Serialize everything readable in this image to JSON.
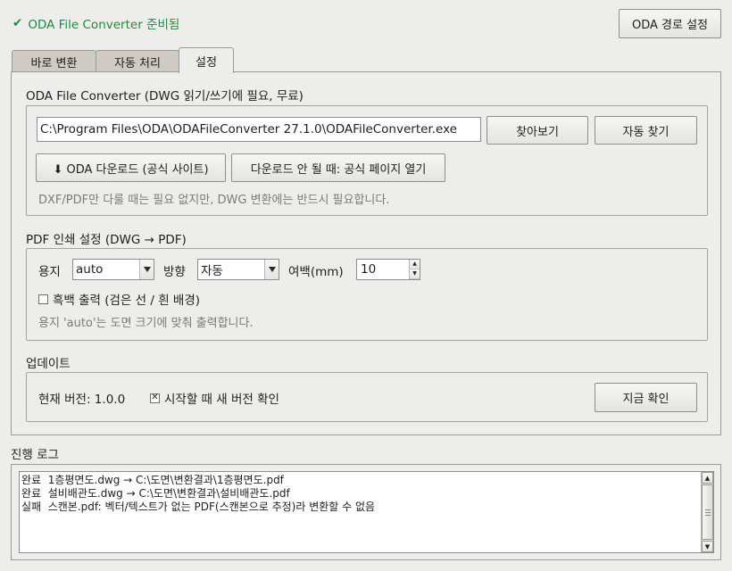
{
  "status": {
    "check_glyph": "✔",
    "text": "ODA File Converter 준비됨",
    "color": "#1f8a3b"
  },
  "oda_path_button": "ODA 경로 설정",
  "tabs": [
    {
      "label": "바로 변환"
    },
    {
      "label": "자동 처리"
    },
    {
      "label": "설정",
      "active": true
    }
  ],
  "settings": {
    "oda_section": {
      "title": "ODA File Converter (DWG 읽기/쓰기에 필요, 무료)",
      "path_value": "C:\\Program Files\\ODA\\ODAFileConverter 27.1.0\\ODAFileConverter.exe",
      "browse_button": "찾아보기",
      "auto_find_button": "자동 찾기",
      "download_button": "⬇ ODA 다운로드 (공식 사이트)",
      "fallback_button": "다운로드 안 될 때: 공식 페이지 열기",
      "hint": "DXF/PDF만 다룰 때는 필요 없지만, DWG 변환에는 반드시 필요합니다."
    },
    "pdf_section": {
      "title": "PDF 인쇄 설정 (DWG → PDF)",
      "paper_label": "용지",
      "paper_value": "auto",
      "orientation_label": "방향",
      "orientation_value": "자동",
      "margin_label": "여백(mm)",
      "margin_value": "10",
      "mono_label": "흑백 출력 (검은 선 / 흰 배경)",
      "mono_checked": false,
      "hint": "용지 'auto'는 도면 크기에 맞춰 출력합니다."
    },
    "update_section": {
      "title": "업데이트",
      "current_version": "현재 버전: 1.0.0",
      "check_on_start_label": "시작할 때 새 버전 확인",
      "check_on_start_checked": true,
      "check_now_button": "지금 확인"
    }
  },
  "log": {
    "title": "진행 로그",
    "lines": [
      "완료  1층평면도.dwg → C:\\도면\\변환결과\\1층평면도.pdf",
      "완료  설비배관도.dwg → C:\\도면\\변환결과\\설비배관도.pdf",
      "실패  스캔본.pdf: 벡터/텍스트가 없는 PDF(스캔본으로 추정)라 변환할 수 없음"
    ]
  }
}
